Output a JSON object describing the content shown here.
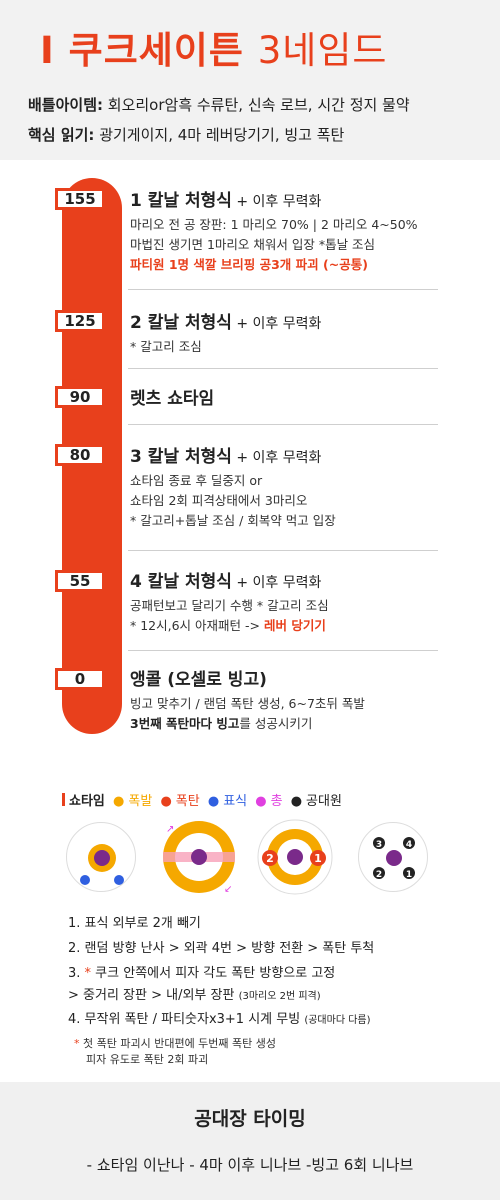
{
  "header": {
    "title_prefix": "I ",
    "title_main": "쿠크세이튼 ",
    "title_gate": "3네임드",
    "info1_key": "배틀아이템:",
    "info1_value": " 회오리or암흑 수류탄, 신속 로브, 시간 정지 물약",
    "info2_key": "핵심 읽기:",
    "info2_value": " 광기게이지, 4마 레버당기기, 빙고 폭탄"
  },
  "timeline": {
    "hp_labels": [
      "155",
      "125",
      "90",
      "80",
      "55",
      "0"
    ],
    "entries": [
      {
        "title": "1 칼날 처형식",
        "suffix": " + 이후 무력화",
        "l1": "마리오 전 공 장판: 1 마리오 70% | 2 마리오 4~50%",
        "l2": "마법진 생기면 1마리오 채워서 입장 *톱날 조심",
        "l3": "파티원 1명 색깔 브리핑 공3개 파괴 (~공통)"
      },
      {
        "title": "2 칼날 처형식",
        "suffix": " + 이후 무력화",
        "l1": "* 갈고리 조심"
      },
      {
        "title": "렛츠 쇼타임"
      },
      {
        "title": "3 칼날 처형식",
        "suffix": " + 이후 무력화",
        "l1": "쇼타임 종료 후 딜중지 or",
        "l2": "쇼타임 2회 피격상태에서 3마리오",
        "l3": "* 갈고리+톱날 조심 / 회복약 먹고 입장"
      },
      {
        "title": "4 칼날 처형식",
        "suffix": " + 이후 무력화",
        "l1": "공패턴보고 달리기 수행  * 갈고리 조심",
        "l2a": "* 12시,6시 아재패턴 -> ",
        "l2b": "레버 당기기"
      },
      {
        "title": "앵콜 (오셀로 빙고)",
        "l1": "빙고 맞추기 / 랜덤 폭탄 생성, 6~7초뒤 폭발",
        "l2a": "3번째 폭탄마다 빙고",
        "l2b": "를 성공시키기"
      }
    ]
  },
  "legend": {
    "showtime": "쇼타임",
    "explosion": "폭발",
    "bomb": "폭탄",
    "mark": "표식",
    "gun": "총",
    "big_ball": "공대원",
    "colors": {
      "accent": "#e8401c",
      "explosion": "#f5a800",
      "bomb": "#e8401c",
      "mark": "#2f5fe0",
      "gun": "#e040e0",
      "big_ball": "#222222"
    }
  },
  "circles": {
    "c2_badges": [
      "2",
      "1"
    ],
    "c4_numbers": [
      "3",
      "4",
      "2",
      "1"
    ]
  },
  "steps": {
    "s1": "1. 표식 외부로 2개 빼기",
    "s2": "2. 랜덤 방향 난사 > 외곽 4번 > 방향 전환 > 폭탄 투척",
    "s3a": "3. ",
    "s3star": "*",
    "s3b": " 쿠크 안쪽에서 피자 각도 폭탄 방향으로 고정",
    "s3c": ">  중거리 장판 > 내/외부 장판 ",
    "s3c_small": "(3마리오 2번 피격)",
    "s4": "4.  무작위 폭탄 / 파티숫자x3+1 시계 무빙 ",
    "s4_small": "(공대마다 다름)",
    "note_star": "*",
    "note1": " 첫 폭탄 파괴시 반대편에 두번째 폭탄 생성",
    "note2": "피자 유도로 폭탄 2회 파괴"
  },
  "footer": {
    "title": "공대장 타이밍",
    "line": "- 쇼타임 이난나   - 4마 이후 니나브   -빙고 6회 니나브"
  }
}
